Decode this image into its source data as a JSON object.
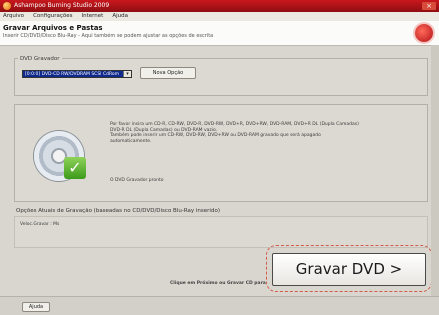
{
  "window": {
    "title": "Ashampoo Burning Studio 2009",
    "close_glyph": "×"
  },
  "menu": [
    "Arquivo",
    "Configurações",
    "Internet",
    "Ajuda"
  ],
  "header": {
    "title": "Gravar Arquivos e Pastas",
    "subtitle": "Inserir CD/DVD/Disco Blu-Ray - Aqui também se podem ajustar as opções de escrita"
  },
  "drive_group": {
    "label": "DVD Gravador",
    "drive_value": "[0:0:0] DVD-CD RW/DVDRAM SCSI CdRom",
    "refresh_label": "Nova Opção"
  },
  "disc_info": {
    "line1": "Por favor insira um CD-R, CD-RW, DVD-R, DVD-RW, DVD+R, DVD+RW, DVD-RAM, DVD+R DL (Dupla Camadas)",
    "line2": "DVD-R DL (Dupla Camadas) ou DVD-RAM vazio.",
    "line3": "Também pode inserir um CD-RW, DVD-RW, DVD+RW ou DVD-RAM gravado que será apagado",
    "line4": "automaticamente.",
    "status": "O DVD Gravador pronto"
  },
  "write_options": {
    "label": "Opções Atuais de Gravação (baseadas no CD/DVD/Disco Blu-Ray inserido)",
    "speed_label": "Veloc.Gravar : Ms"
  },
  "footer": {
    "hint": "Clique em Próximo ou Gravar CD para",
    "burn_label": "Gravar DVD >",
    "help_label": "Ajuda"
  }
}
